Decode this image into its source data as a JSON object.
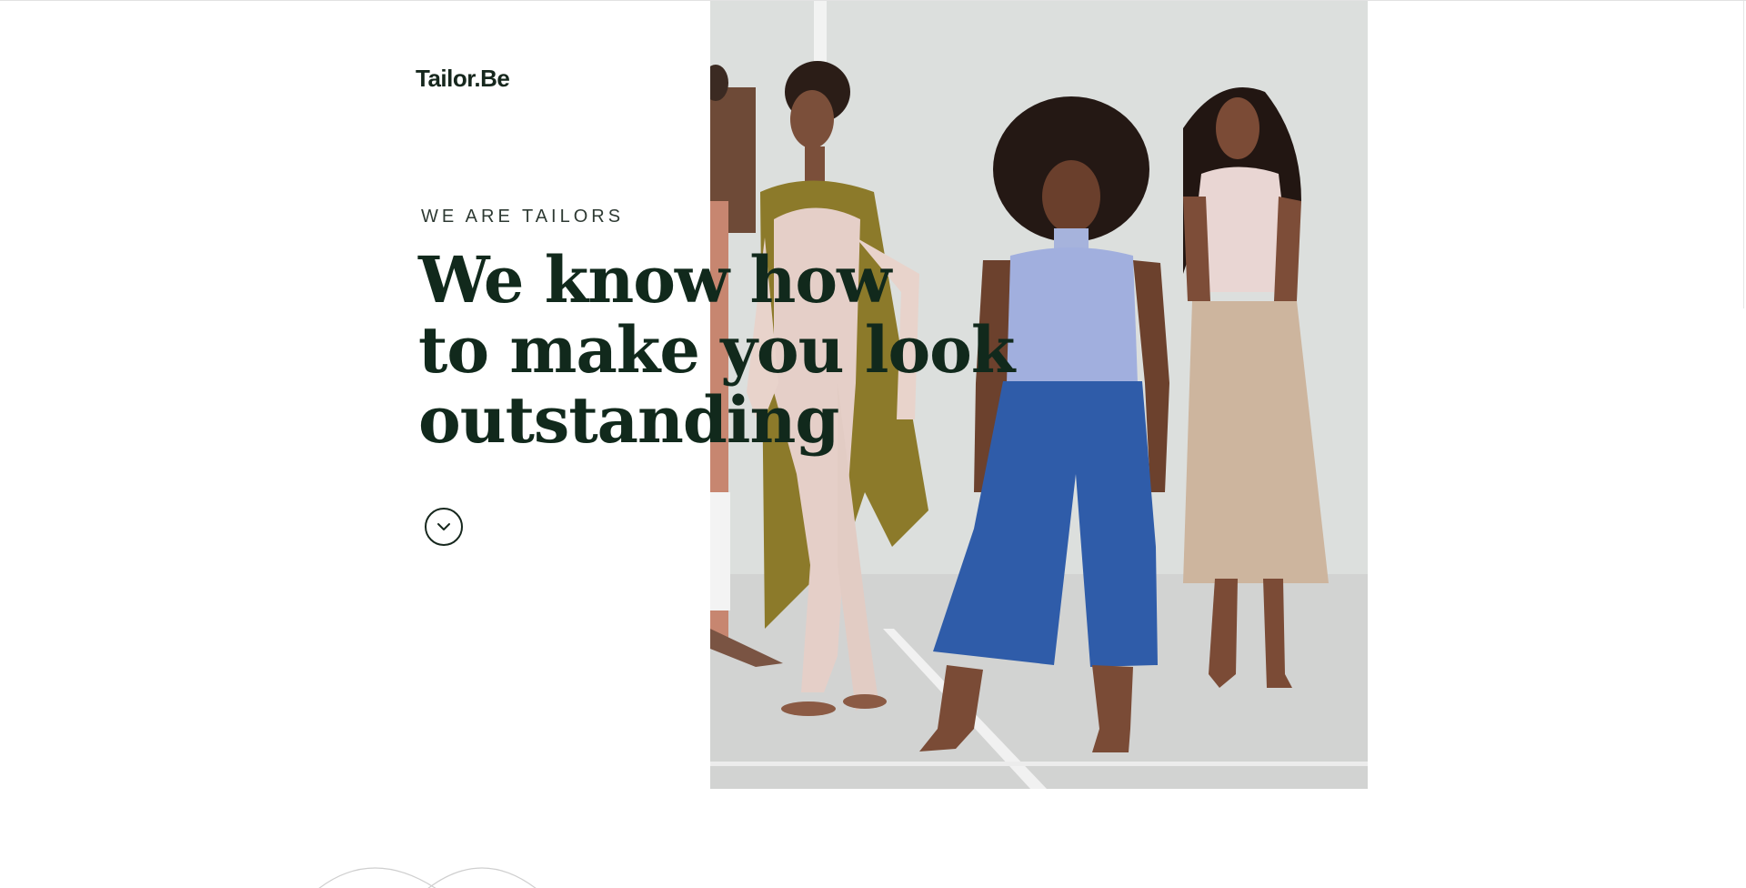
{
  "brand": {
    "logo_text": "Tailor.Be"
  },
  "hero": {
    "eyebrow": "WE ARE TAILORS",
    "headline_lines": [
      "We know how",
      "to make you look",
      "outstanding"
    ],
    "scroll_icon": "chevron-down-icon",
    "photo": "models-group-photo"
  },
  "colors": {
    "text_dark_green": "#11291c",
    "background": "#ffffff",
    "photo_wall": "#dde0de"
  }
}
